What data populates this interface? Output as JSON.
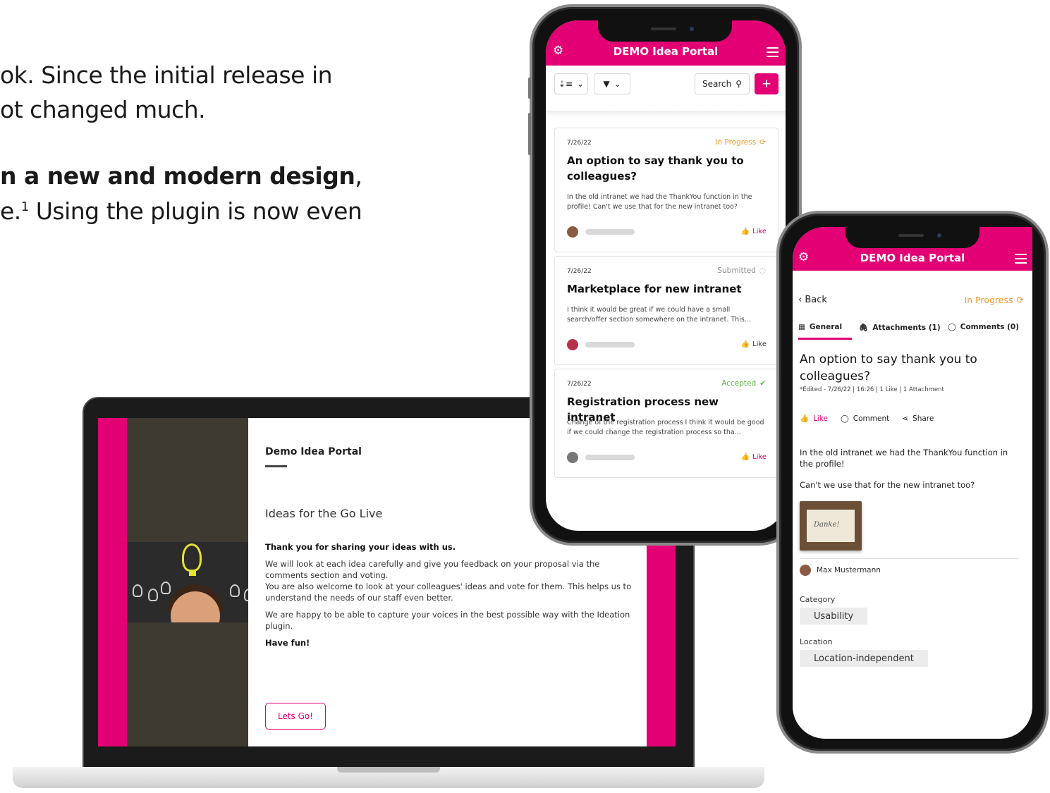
{
  "intro": {
    "line1": "ok. Since the initial release in",
    "line2": "ot changed much.",
    "line3_bold": "n a new and modern design",
    "line3_tail": ",",
    "line4_pre": "e.",
    "line4_sup": "1",
    "line4_post": " Using the plugin is now even"
  },
  "laptop": {
    "portal_title": "Demo Idea Portal",
    "subtitle": "Ideas for the Go Live",
    "thanks": "Thank you for sharing your ideas with us.",
    "para1": "We will look at each idea carefully and give you feedback on your proposal via the comments section and voting.",
    "para2": "You are also welcome to look at your colleagues' ideas and vote for them. This helps us to understand the needs of our staff even better.",
    "para3": "We are happy to be able to capture your voices in the best possible way with the Ideation plugin.",
    "fun": "Have fun!",
    "button": "Lets Go!"
  },
  "phone_list": {
    "app_title": "DEMO Idea Portal",
    "search_label": "Search",
    "ideas": [
      {
        "date": "7/26/22",
        "status": "In Progress",
        "title": "An option to say thank you to colleagues?",
        "excerpt": "In the old intranet we had the ThankYou function in the profile! Can't we use that for the new intranet too?",
        "like_label": "Like",
        "liked": true
      },
      {
        "date": "7/26/22",
        "status": "Submitted",
        "title": "Marketplace for new intranet",
        "excerpt": "I think it would be great if we could have a small search/offer section somewhere on the intranet. This...",
        "like_label": "Like",
        "liked": false
      },
      {
        "date": "7/26/22",
        "status": "Accepted",
        "title": "Registration process new intranet",
        "excerpt": "Change of the registration process I think it would be good if we could change the registration process so tha...",
        "like_label": "Like",
        "liked": true
      }
    ]
  },
  "phone_detail": {
    "app_title": "DEMO Idea Portal",
    "back": "Back",
    "status": "In Progress",
    "tabs": [
      "General",
      "Attachments (1)",
      "Comments (0)"
    ],
    "title": "An option to say thank you to colleagues?",
    "meta": "*Edited - 7/26/22   |   16:26   |   1 Like   |   1 Attachment",
    "actions": {
      "like": "Like",
      "comment": "Comment",
      "share": "Share"
    },
    "body1": "In the old intranet we had the ThankYou function in the profile!",
    "body2": "Can't we use that for the new intranet too?",
    "attachment_text": "Danke!",
    "author": "Max Mustermann",
    "category_label": "Category",
    "category_value": "Usability",
    "location_label": "Location",
    "location_value": "Location-independent"
  },
  "colors": {
    "brand": "#e20074",
    "in_progress": "#f29a2e",
    "submitted": "#8a8a8a",
    "accepted": "#5eb044"
  }
}
